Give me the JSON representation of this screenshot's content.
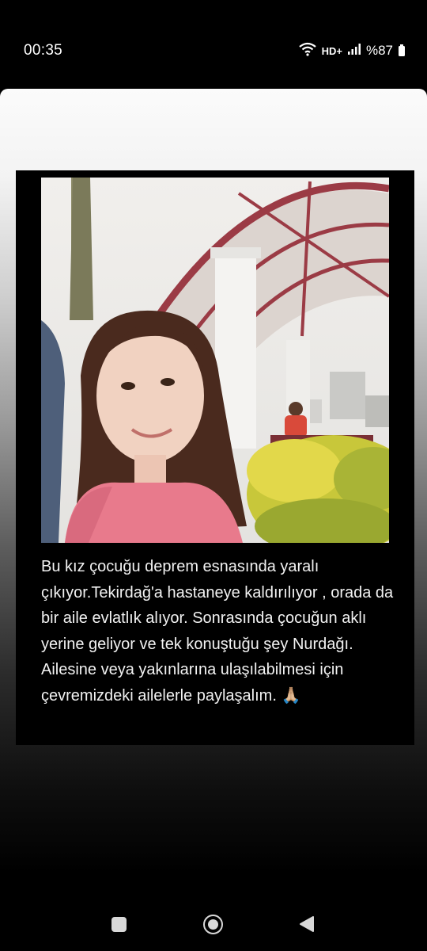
{
  "status_bar": {
    "time": "00:35",
    "network_label": "HD+",
    "battery_text": "%87",
    "icons": [
      "wifi-icon",
      "signal-icon",
      "battery-icon"
    ]
  },
  "post": {
    "photo_icon": "photo-girl-park",
    "text": "Bu kız çocuğu deprem esnasında yaralı çıkıyor.Tekirdağ'a hastaneye kaldırılıyor , orada da bir aile evlatlık alıyor. Sonrasında çocuğun aklı yerine geliyor ve tek konuştuğu şey Nurdağı. Ailesine veya yakınlarına ulaşılabilmesi için çevremizdeki ailelerle paylaşalım.",
    "emoji": "🙏🏼"
  },
  "nav_bar": {
    "icons": [
      "recents-icon",
      "home-icon",
      "back-icon"
    ]
  },
  "colors": {
    "background": "#000000",
    "frame_top": "#fbfbfb",
    "text": "#f2f2f2"
  }
}
